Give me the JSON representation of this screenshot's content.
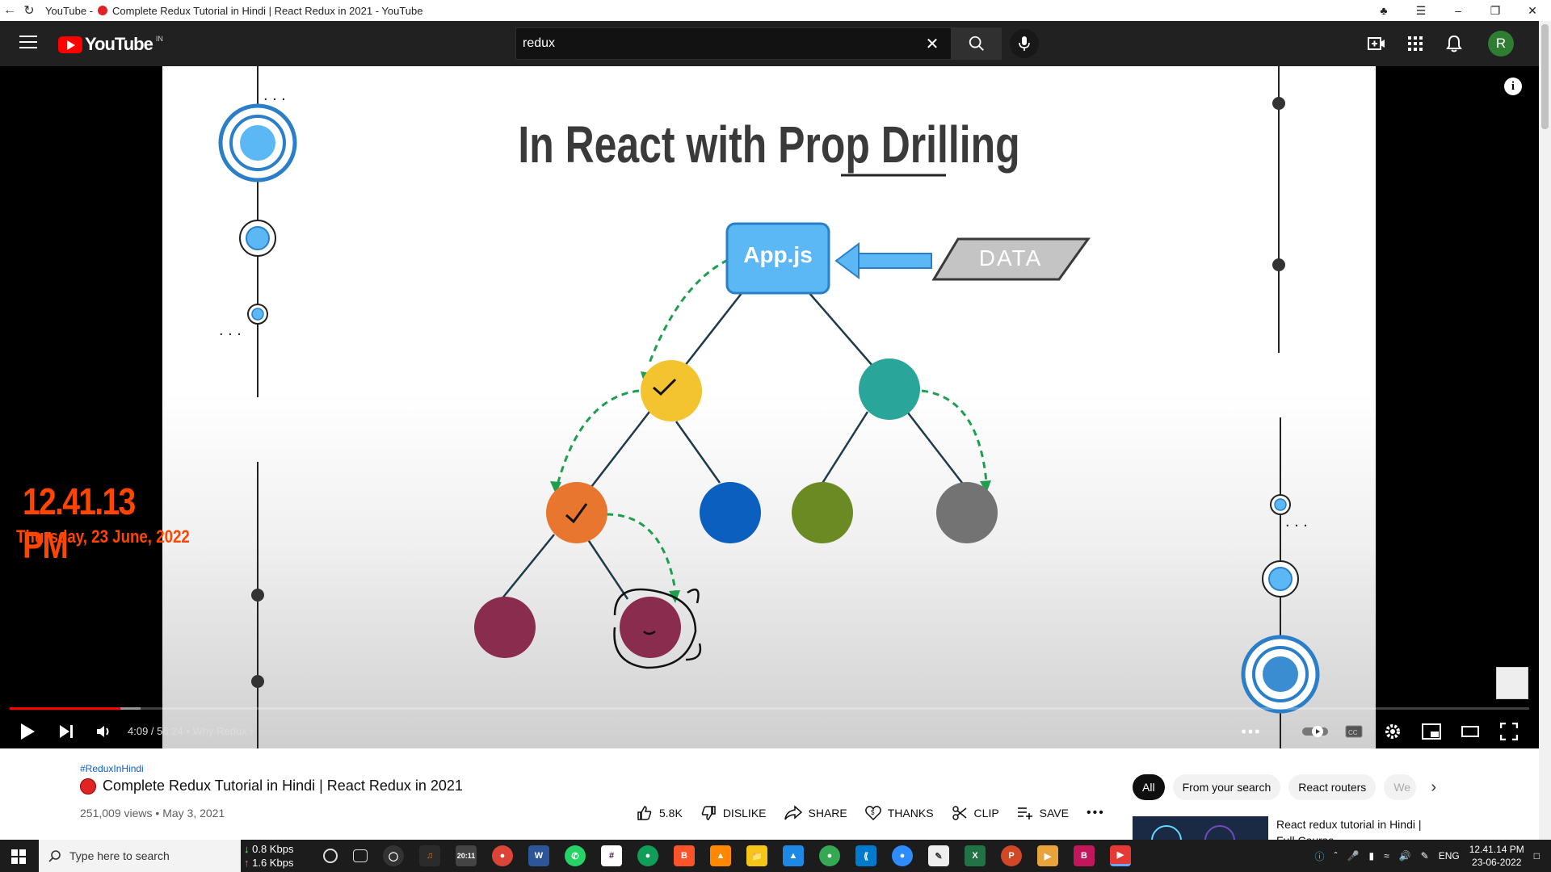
{
  "browser": {
    "tab_title": "YouTube - ",
    "tab_title_video": "Complete Redux Tutorial in Hindi | React Redux in 2021 - YouTube"
  },
  "header": {
    "logo_text": "YouTube",
    "country": "IN",
    "search_value": "redux",
    "avatar_initial": "R"
  },
  "player": {
    "slide_title": "In React with Prop Drilling",
    "app_node_label": "App.js",
    "data_label": "DATA",
    "clock_time": "12.41.13 PM",
    "clock_date": "Thursday, 23 June, 2022",
    "time_current": "4:09",
    "time_total": "56:24",
    "chapter": "Why Redux",
    "progress_played": 0.073,
    "progress_loaded": 0.086
  },
  "video": {
    "hashtag": "#ReduxInHindi",
    "title": "Complete Redux Tutorial in Hindi | React Redux in 2021",
    "views": "251,009 views",
    "date": "May 3, 2021",
    "actions": [
      {
        "name": "like",
        "label": "5.8K"
      },
      {
        "name": "dislike",
        "label": "DISLIKE"
      },
      {
        "name": "share",
        "label": "SHARE"
      },
      {
        "name": "thanks",
        "label": "THANKS"
      },
      {
        "name": "clip",
        "label": "CLIP"
      },
      {
        "name": "save",
        "label": "SAVE"
      }
    ]
  },
  "chips": [
    "All",
    "From your search",
    "React routers",
    "We"
  ],
  "recommended": {
    "title": "Reac redux tutorial in Hindi | Full Course",
    "title_exact": "React redux tutorial in Hindi | Full Course"
  },
  "taskbar": {
    "search_placeholder": "Type here to search",
    "net_down": "0.8 Kbps",
    "net_up": "1.6 Kbps",
    "lang": "ENG",
    "time": "12.41.14 PM",
    "date": "23-06-2022"
  },
  "colors": {
    "accent_red": "#ff0000",
    "clock_orange": "#ff4500",
    "app_node": "#5bb8f5"
  }
}
